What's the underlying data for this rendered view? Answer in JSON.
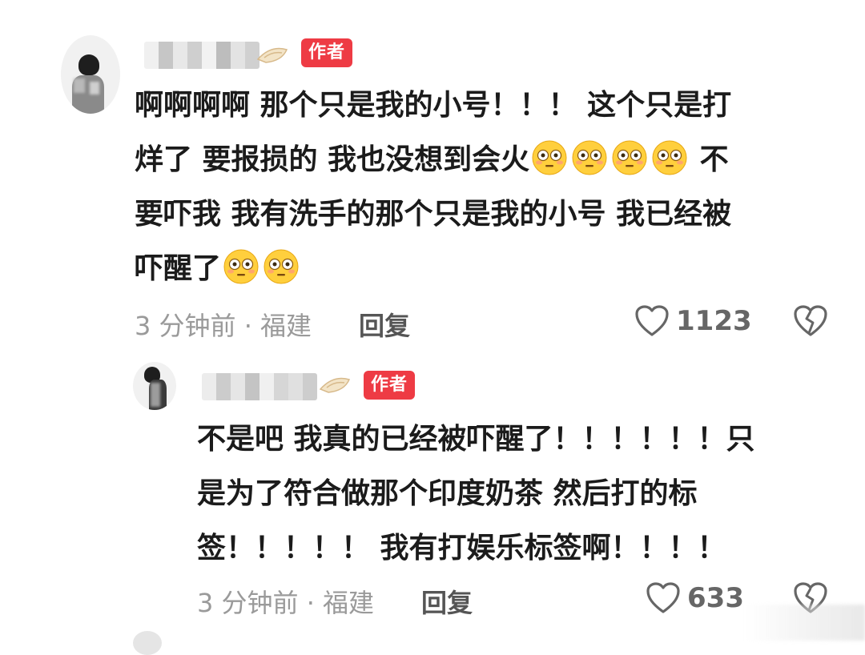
{
  "comment": {
    "author_badge": "作者",
    "lines": [
      "啊啊啊啊 那个只是我的小号！！！ 这个只是打",
      "烊了 要报损的 我也没想到会火",
      "不",
      "要吓我 我有洗手的那个只是我的小号 我已经被",
      "吓醒了"
    ],
    "meta": "3 分钟前 · 福建",
    "reply_label": "回复",
    "like_count": "1123"
  },
  "reply": {
    "author_badge": "作者",
    "lines": [
      "不是吧 我真的已经被吓醒了！！！！！！只",
      "是为了符合做那个印度奶茶 然后打的标",
      "签！！！！！ 我有打娱乐标签啊！！！！"
    ],
    "meta": "3 分钟前 · 福建",
    "reply_label": "回复",
    "like_count": "633"
  },
  "icons": {
    "emoji": "flushed-face-emoji",
    "like": "heart-outline-icon",
    "dislike": "broken-heart-icon"
  },
  "colors": {
    "author_badge": "#ee3b44",
    "meta_text": "#9a9a9a",
    "comment_text": "#1b1b1b"
  }
}
